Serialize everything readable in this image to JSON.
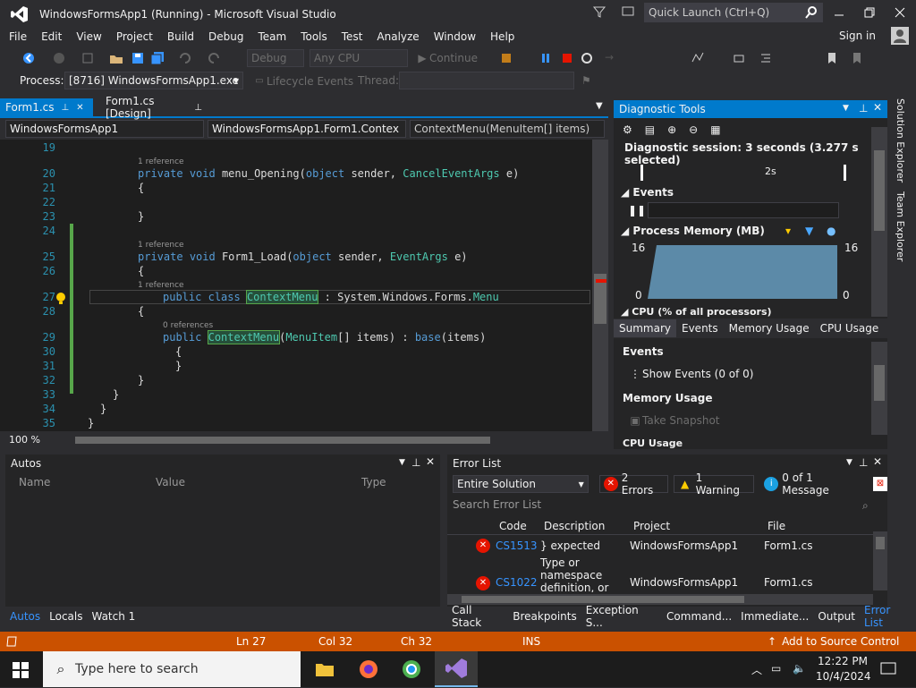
{
  "window": {
    "title": "WindowsFormsApp1 (Running) - Microsoft Visual Studio",
    "quick_launch": "Quick Launch (Ctrl+Q)",
    "sign_in": "Sign in"
  },
  "menu": [
    "File",
    "Edit",
    "View",
    "Project",
    "Build",
    "Debug",
    "Team",
    "Tools",
    "Test",
    "Analyze",
    "Window",
    "Help"
  ],
  "toolbar": {
    "config": "Debug",
    "platform": "Any CPU",
    "continue": "Continue"
  },
  "process": {
    "label": "Process:",
    "value": "[8716] WindowsFormsApp1.exe",
    "lifecycle": "Lifecycle Events",
    "thread": "Thread:"
  },
  "doc_tabs": [
    "Form1.cs",
    "Form1.cs [Design]"
  ],
  "nav": {
    "project": "WindowsFormsApp1",
    "class": "WindowsFormsApp1.Form1.Contex",
    "member": "ContextMenu(MenuItem[] items)"
  },
  "code": {
    "lines": [
      {
        "n": "19",
        "text": ""
      },
      {
        "n": "",
        "ref": "1 reference"
      },
      {
        "n": "20",
        "text": "private void menu_Opening(object sender, CancelEventArgs e)"
      },
      {
        "n": "21",
        "text": "{"
      },
      {
        "n": "22",
        "text": ""
      },
      {
        "n": "23",
        "text": "}"
      },
      {
        "n": "24",
        "text": ""
      },
      {
        "n": "",
        "ref": "1 reference"
      },
      {
        "n": "25",
        "text": "private void Form1_Load(object sender, EventArgs e)"
      },
      {
        "n": "26",
        "text": "{"
      },
      {
        "n": "",
        "ref": "1 reference"
      },
      {
        "n": "27",
        "text": "public class ContextMenu : System.Windows.Forms.Menu"
      },
      {
        "n": "28",
        "text": "{"
      },
      {
        "n": "",
        "ref": "0 references"
      },
      {
        "n": "29",
        "text": "public ContextMenu(MenuItem[] items) : base(items)"
      },
      {
        "n": "30",
        "text": "{"
      },
      {
        "n": "31",
        "text": "}"
      },
      {
        "n": "32",
        "text": "}"
      },
      {
        "n": "33",
        "text": "}"
      },
      {
        "n": "34",
        "text": "}"
      },
      {
        "n": "35",
        "text": "}"
      }
    ],
    "zoom": "100 %"
  },
  "diag": {
    "title": "Diagnostic Tools",
    "session": "Diagnostic session: 3 seconds (3.277 s selected)",
    "timeline": "2s",
    "events": "Events",
    "memory": "Process Memory (MB)",
    "mem_max": "16",
    "mem_min": "0",
    "cpu": "CPU (% of all processors)",
    "tabs": [
      "Summary",
      "Events",
      "Memory Usage",
      "CPU Usage"
    ],
    "sum_events": "Events",
    "show_events": "Show Events (0 of 0)",
    "sum_memory": "Memory Usage",
    "take_snapshot": "Take Snapshot",
    "sum_cpu": "CPU Usage"
  },
  "side_tabs": [
    "Solution Explorer",
    "Team Explorer"
  ],
  "autos": {
    "title": "Autos",
    "cols": [
      "Name",
      "Value",
      "Type"
    ],
    "tabs": [
      "Autos",
      "Locals",
      "Watch 1"
    ]
  },
  "errors": {
    "title": "Error List",
    "scope": "Entire Solution",
    "errors": "2 Errors",
    "warnings": "1 Warning",
    "messages": "0 of 1 Message",
    "search": "Search Error List",
    "cols": [
      "Code",
      "Description",
      "Project",
      "File"
    ],
    "rows": [
      {
        "code": "CS1513",
        "desc": "} expected",
        "project": "WindowsFormsApp1",
        "file": "Form1.cs"
      },
      {
        "code": "CS1022",
        "desc": "Type or namespace definition, or end-",
        "project": "WindowsFormsApp1",
        "file": "Form1.cs"
      }
    ]
  },
  "bottom_tabs": [
    "Call Stack",
    "Breakpoints",
    "Exception S...",
    "Command...",
    "Immediate...",
    "Output",
    "Error List"
  ],
  "status": {
    "ln": "Ln 27",
    "col": "Col 32",
    "ch": "Ch 32",
    "ins": "INS",
    "source": "Add to Source Control"
  },
  "taskbar": {
    "search": "Type here to search",
    "time": "12:22 PM",
    "date": "10/4/2024"
  },
  "colors": {
    "accent": "#007acc",
    "status": "#ca5100",
    "error": "#e51400",
    "warning": "#ffcc00"
  }
}
